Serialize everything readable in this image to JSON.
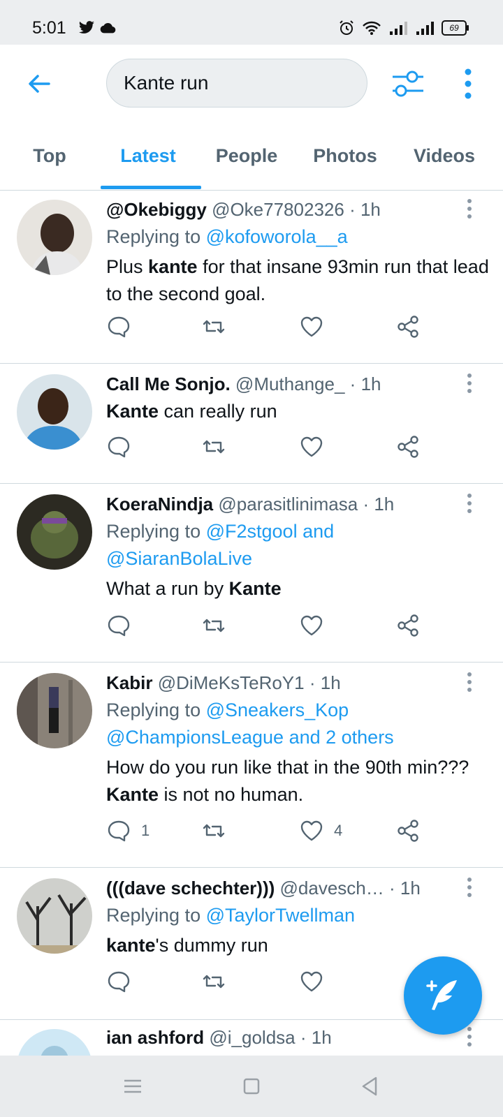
{
  "status_bar": {
    "time": "5:01",
    "battery": "69"
  },
  "search": {
    "query": "Kante run"
  },
  "tabs": [
    {
      "label": "Top"
    },
    {
      "label": "Latest"
    },
    {
      "label": "People"
    },
    {
      "label": "Photos"
    },
    {
      "label": "Videos"
    }
  ],
  "tweets": [
    {
      "name": "@Okebiggy",
      "handle": "@Oke77802326",
      "time": "1h",
      "replying_to": "Replying to",
      "reply_target": "@kofoworola__a",
      "text_before": "Plus ",
      "text_bold": "kante",
      "text_after": " for that insane 93min run that lead to the second goal."
    },
    {
      "name": "Call Me Sonjo.",
      "handle": "@Muthange_",
      "time": "1h",
      "text_before": "",
      "text_bold": "Kante",
      "text_after": " can really run"
    },
    {
      "name": "KoeraNindja",
      "handle": "@parasitlinimasa",
      "time": "1h",
      "replying_to": "Replying to",
      "reply_target": "@F2stgool and @SiaranBolaLive",
      "text_before": "What a run by ",
      "text_bold": "Kante",
      "text_after": ""
    },
    {
      "name": "Kabir",
      "handle": "@DiMeKsTeRoY1",
      "time": "1h",
      "replying_to": "Replying to",
      "reply_target": "@Sneakers_Kop @ChampionsLeague and 2 others",
      "text_before": "How do you run like that in the 90th min??? ",
      "text_bold": "Kante",
      "text_after": " is not no human.",
      "reply_count": "1",
      "like_count": "4"
    },
    {
      "name": "(((dave schechter)))",
      "handle": "@davesch…",
      "time": "1h",
      "replying_to": "Replying to",
      "reply_target": "@TaylorTwellman",
      "text_before": "",
      "text_bold": "kante",
      "text_after": "'s dummy run"
    },
    {
      "name": "ian ashford",
      "handle": "@i_goldsa",
      "time": "1h"
    }
  ]
}
